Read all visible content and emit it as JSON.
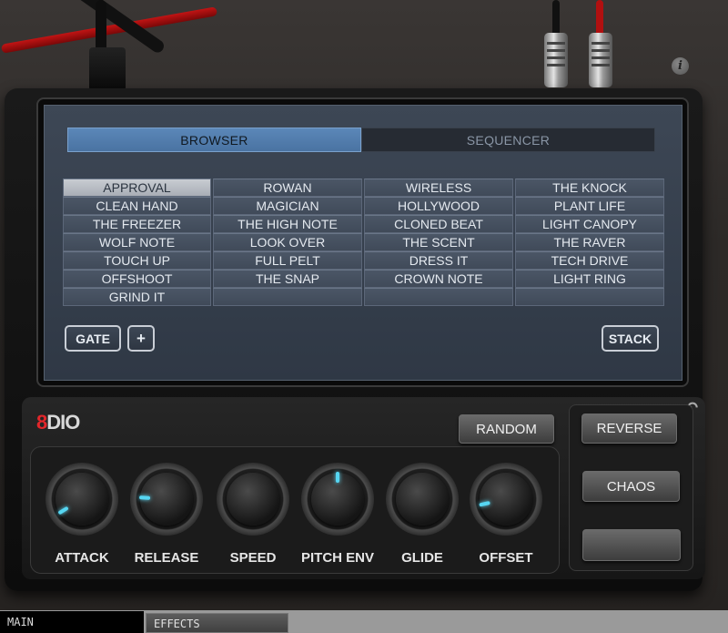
{
  "tabs": {
    "browser": "BROWSER",
    "sequencer": "SEQUENCER",
    "active": "BROWSER"
  },
  "presets": {
    "columns": [
      [
        "APPROVAL",
        "CLEAN HAND",
        "THE FREEZER",
        "WOLF NOTE",
        "TOUCH UP",
        "OFFSHOOT",
        "GRIND IT"
      ],
      [
        "ROWAN",
        "MAGICIAN",
        "THE HIGH NOTE",
        "LOOK OVER",
        "FULL PELT",
        "THE SNAP",
        ""
      ],
      [
        "WIRELESS",
        "HOLLYWOOD",
        "CLONED BEAT",
        "THE SCENT",
        "DRESS IT",
        "CROWN NOTE",
        ""
      ],
      [
        "THE KNOCK",
        "PLANT LIFE",
        "LIGHT CANOPY",
        "THE RAVER",
        "TECH DRIVE",
        "LIGHT RING",
        ""
      ]
    ],
    "selected": "APPROVAL"
  },
  "screen_buttons": {
    "gate": "GATE",
    "plus": "+",
    "stack": "STACK"
  },
  "logo": {
    "digit": "8",
    "text": "DIO"
  },
  "info_icon": "i",
  "undo_icon": "↶",
  "buttons": {
    "random": "RANDOM",
    "reverse": "REVERSE",
    "chaos": "CHAOS",
    "blank": ""
  },
  "knobs": [
    {
      "label": "ATTACK",
      "level": 0.05
    },
    {
      "label": "RELEASE",
      "level": 0.18
    },
    {
      "label": "SPEED",
      "level": null
    },
    {
      "label": "PITCH ENV",
      "level": 0.5
    },
    {
      "label": "GLIDE",
      "level": null
    },
    {
      "label": "OFFSET",
      "level": 0.12
    }
  ],
  "bottom_tabs": {
    "main": "MAIN",
    "effects": "EFFECTS"
  },
  "colors": {
    "accent_blue": "#5b87b8",
    "indicator_cyan": "#56d6f2",
    "logo_red": "#e2262a"
  }
}
